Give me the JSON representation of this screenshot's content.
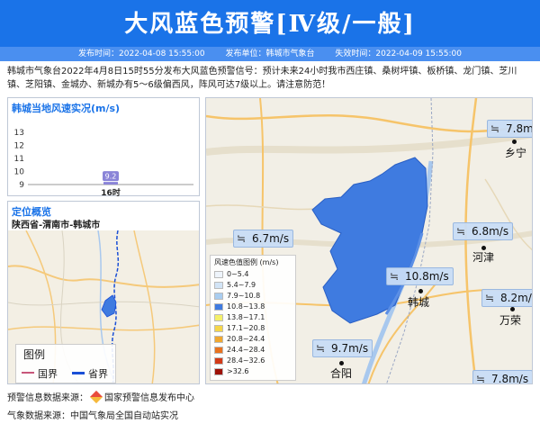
{
  "header": {
    "title": "大风蓝色预警[Ⅳ级/一般]",
    "publish_time": "发布时间：2022-04-08 15:55:00",
    "publisher": "发布单位：韩城市气象台",
    "expire_time": "失效时间：2022-04-09 15:55:00"
  },
  "description": "韩城市气象台2022年4月8日15时55分发布大风蓝色预警信号：预计未来24小时我市西庄镇、桑树坪镇、板桥镇、龙门镇、芝川镇、芝阳镇、金城办、新城办有5～6级偏西风，阵风可达7级以上。请注意防范！",
  "wind_panel": {
    "title": "韩城当地风速实况(m/s)"
  },
  "chart_data": {
    "type": "bar",
    "title": "韩城当地风速实况(m/s)",
    "categories": [
      "16时"
    ],
    "values": [
      9.2
    ],
    "ylim": [
      9,
      13
    ],
    "yticks": [
      9,
      10,
      11,
      12,
      13
    ],
    "bar_color": "#8a84d8",
    "grid": false
  },
  "location": {
    "title": "定位概览",
    "subtitle": "陕西省-渭南市-韩城市",
    "legend_title": "图例",
    "legend_items": [
      {
        "label": "国界",
        "color": "#c8567a"
      },
      {
        "label": "省界",
        "color": "#1a4fd6"
      }
    ]
  },
  "main_map": {
    "wind_labels": [
      {
        "text": "7.8m/s"
      },
      {
        "text": "6.7m/s"
      },
      {
        "text": "6.8m/s"
      },
      {
        "text": "10.8m/s"
      },
      {
        "text": "8.2m/s"
      },
      {
        "text": "9.7m/s"
      },
      {
        "text": "7.8m/s"
      }
    ],
    "wind_symbol": "≒",
    "towns": [
      {
        "name": "乡宁"
      },
      {
        "name": "河津"
      },
      {
        "name": "韩城"
      },
      {
        "name": "万荣"
      },
      {
        "name": "合阳"
      }
    ],
    "region_color": "#3f7be0",
    "scale_title": "风速色值图例 (m/s)",
    "scale": [
      {
        "label": "0~5.4",
        "color": "#eef4fb"
      },
      {
        "label": "5.4~7.9",
        "color": "#d2e4f6"
      },
      {
        "label": "7.9~10.8",
        "color": "#a9cdf0"
      },
      {
        "label": "10.8~13.8",
        "color": "#3f7be0"
      },
      {
        "label": "13.8~17.1",
        "color": "#f4f06a"
      },
      {
        "label": "17.1~20.8",
        "color": "#f5d64a"
      },
      {
        "label": "20.8~24.4",
        "color": "#f0a830"
      },
      {
        "label": "24.4~28.4",
        "color": "#e87320"
      },
      {
        "label": "28.4~32.6",
        "color": "#d23a18"
      },
      {
        "label": ">32.6",
        "color": "#9e1208"
      }
    ]
  },
  "footer": {
    "warning_source_label": "预警信息数据来源：",
    "warning_source": "国家预警信息发布中心",
    "weather_source": "气象数据来源：中国气象局全国自动站实况"
  }
}
